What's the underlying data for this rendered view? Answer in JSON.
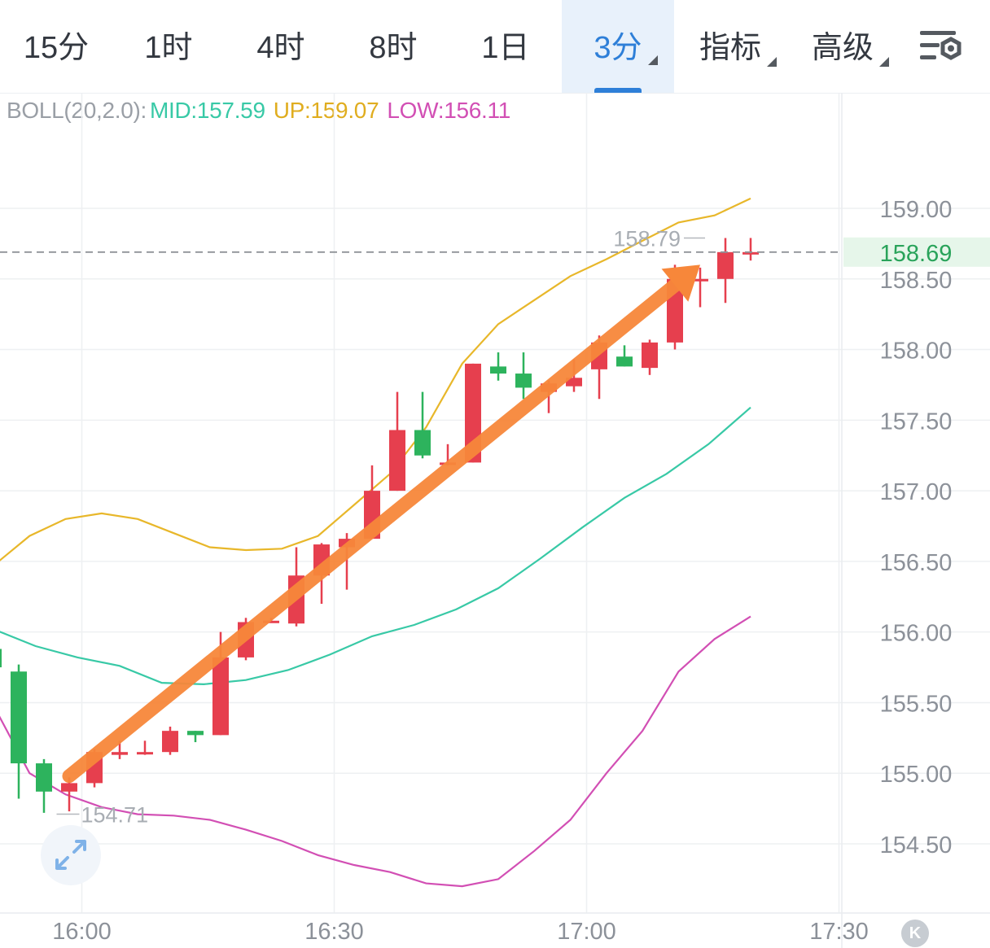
{
  "tabs": [
    {
      "label": "15分",
      "active": false,
      "menu": false
    },
    {
      "label": "1时",
      "active": false,
      "menu": false
    },
    {
      "label": "4时",
      "active": false,
      "menu": false
    },
    {
      "label": "8时",
      "active": false,
      "menu": false
    },
    {
      "label": "1日",
      "active": false,
      "menu": false
    },
    {
      "label": "3分",
      "active": true,
      "menu": true
    },
    {
      "label": "指标",
      "active": false,
      "menu": true
    },
    {
      "label": "高级",
      "active": false,
      "menu": true
    }
  ],
  "icons": {
    "settings": "settings-icon",
    "expand": "expand-arrows-icon",
    "k": "k-badge-icon"
  },
  "indicator": {
    "name": "BOLL(20,2.0):",
    "mid": "MID:157.59",
    "up": "UP:159.07",
    "low": "LOW:156.11"
  },
  "k_badge": "K",
  "colors": {
    "accent": "#2e7fd8",
    "up_candle": "#e63f4e",
    "down_candle": "#2db35d",
    "mid_line": "#38c9a6",
    "upper_line": "#e8b72a",
    "lower_line": "#d24fb4",
    "trend_arrow": "#f7873a",
    "grid": "#eef0f2",
    "axis_text": "#8c9199"
  },
  "chart_data": {
    "type": "candlestick",
    "ylim": [
      154.05,
      159.7
    ],
    "y_ticks": [
      "159.00",
      "158.50",
      "158.00",
      "157.50",
      "157.00",
      "156.50",
      "156.00",
      "155.50",
      "155.00",
      "154.50"
    ],
    "x_ticks": [
      "16:00",
      "16:30",
      "17:00",
      "17:30"
    ],
    "x_tick_index": [
      3.5,
      13.5,
      23.5,
      33.5
    ],
    "current_price": "158.69",
    "current_value": 158.69,
    "max_label": "158.79",
    "max_value": 158.79,
    "max_index": 28,
    "min_label": "154.71",
    "min_value": 154.71,
    "min_index": 2.5,
    "candles": [
      {
        "o": 155.88,
        "h": 155.9,
        "l": 155.75,
        "c": 155.75
      },
      {
        "o": 155.72,
        "h": 155.77,
        "l": 154.82,
        "c": 155.07
      },
      {
        "o": 155.07,
        "h": 155.1,
        "l": 154.72,
        "c": 154.87
      },
      {
        "o": 154.87,
        "h": 154.97,
        "l": 154.73,
        "c": 154.93
      },
      {
        "o": 154.93,
        "h": 155.17,
        "l": 154.9,
        "c": 155.15
      },
      {
        "o": 155.13,
        "h": 155.23,
        "l": 155.1,
        "c": 155.15
      },
      {
        "o": 155.15,
        "h": 155.23,
        "l": 155.13,
        "c": 155.15
      },
      {
        "o": 155.15,
        "h": 155.33,
        "l": 155.13,
        "c": 155.3
      },
      {
        "o": 155.3,
        "h": 155.3,
        "l": 155.22,
        "c": 155.27
      },
      {
        "o": 155.27,
        "h": 156.0,
        "l": 155.27,
        "c": 155.82
      },
      {
        "o": 155.82,
        "h": 156.1,
        "l": 155.8,
        "c": 156.07
      },
      {
        "o": 156.07,
        "h": 156.1,
        "l": 156.07,
        "c": 156.08
      },
      {
        "o": 156.06,
        "h": 156.6,
        "l": 156.04,
        "c": 156.4
      },
      {
        "o": 156.4,
        "h": 156.63,
        "l": 156.2,
        "c": 156.62
      },
      {
        "o": 156.6,
        "h": 156.7,
        "l": 156.3,
        "c": 156.66
      },
      {
        "o": 156.66,
        "h": 157.18,
        "l": 156.66,
        "c": 157.0
      },
      {
        "o": 157.0,
        "h": 157.7,
        "l": 157.0,
        "c": 157.43
      },
      {
        "o": 157.43,
        "h": 157.7,
        "l": 157.23,
        "c": 157.25
      },
      {
        "o": 157.2,
        "h": 157.33,
        "l": 157.18,
        "c": 157.2
      },
      {
        "o": 157.2,
        "h": 157.9,
        "l": 157.2,
        "c": 157.9
      },
      {
        "o": 157.88,
        "h": 157.98,
        "l": 157.78,
        "c": 157.83
      },
      {
        "o": 157.83,
        "h": 157.98,
        "l": 157.65,
        "c": 157.73
      },
      {
        "o": 157.7,
        "h": 157.78,
        "l": 157.55,
        "c": 157.76
      },
      {
        "o": 157.74,
        "h": 157.93,
        "l": 157.7,
        "c": 157.8
      },
      {
        "o": 157.86,
        "h": 158.1,
        "l": 157.65,
        "c": 158.05
      },
      {
        "o": 157.95,
        "h": 158.03,
        "l": 157.88,
        "c": 157.88
      },
      {
        "o": 157.87,
        "h": 158.07,
        "l": 157.82,
        "c": 158.05
      },
      {
        "o": 158.05,
        "h": 158.6,
        "l": 158.0,
        "c": 158.5
      },
      {
        "o": 158.5,
        "h": 158.58,
        "l": 158.3,
        "c": 158.5
      },
      {
        "o": 158.5,
        "h": 158.79,
        "l": 158.33,
        "c": 158.69
      },
      {
        "o": 158.69,
        "h": 158.79,
        "l": 158.63,
        "c": 158.69
      }
    ],
    "series": [
      {
        "name": "UP",
        "values": [
          156.47,
          156.68,
          156.8,
          156.84,
          156.8,
          156.7,
          156.6,
          156.58,
          156.59,
          156.68,
          156.9,
          157.12,
          157.45,
          157.9,
          158.18,
          158.35,
          158.52,
          158.64,
          158.77,
          158.9,
          158.95,
          159.07
        ]
      },
      {
        "name": "MID",
        "values": [
          156.02,
          155.9,
          155.82,
          155.76,
          155.64,
          155.63,
          155.66,
          155.73,
          155.84,
          155.97,
          156.05,
          156.16,
          156.31,
          156.52,
          156.74,
          156.95,
          157.12,
          157.33,
          157.59
        ]
      },
      {
        "name": "LOW",
        "values": [
          155.48,
          155.0,
          154.85,
          154.76,
          154.71,
          154.7,
          154.67,
          154.6,
          154.52,
          154.42,
          154.35,
          154.3,
          154.22,
          154.2,
          154.25,
          154.45,
          154.67,
          155.0,
          155.3,
          155.72,
          155.95,
          156.11
        ]
      },
      {
        "name": "trend",
        "values": [
          {
            "i": 3,
            "v": 154.98
          },
          {
            "i": 28,
            "v": 158.6
          }
        ]
      }
    ]
  }
}
